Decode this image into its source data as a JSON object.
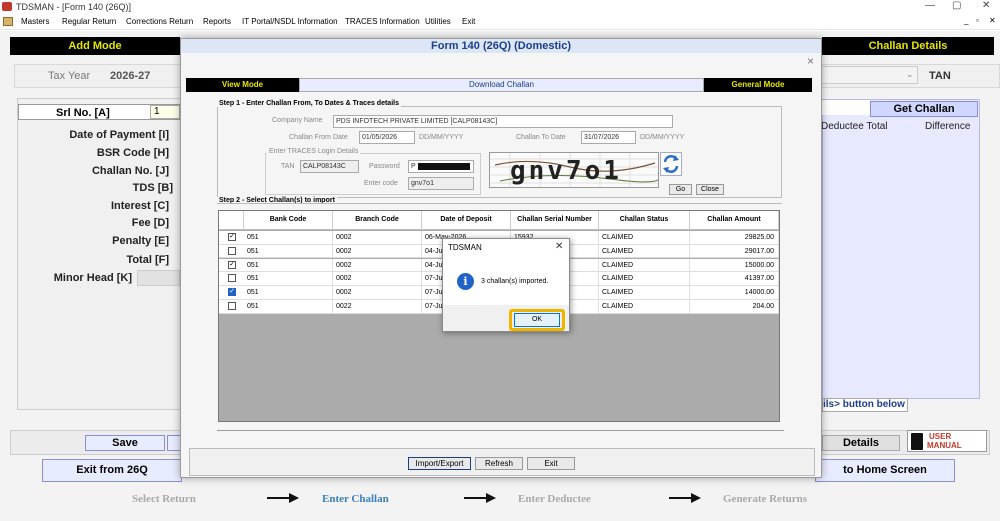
{
  "window": {
    "title": "TDSMAN - [Form 140 (26Q)]"
  },
  "window_controls": {
    "minimize": "—",
    "maximize": "▢",
    "close": "✕"
  },
  "mdi_controls": {
    "minimize": "_",
    "restore": "▫",
    "close": "✕"
  },
  "menu": [
    "Masters",
    "Regular Return",
    "Corrections Return",
    "Reports",
    "IT Portal/NSDL Information",
    "TRACES Information",
    "Utilities",
    "Exit"
  ],
  "background": {
    "add_mode": "Add Mode",
    "challan_details": "Challan Details",
    "tax_year_label": "Tax Year",
    "tax_year_value": "2026-27",
    "tan_label": "TAN",
    "srl_no_label": "Srl No. [A]",
    "srl_no_value": "1",
    "labels": [
      "Date of Payment [I]",
      "BSR Code [H]",
      "Challan No. [J]",
      "TDS [B]",
      "Interest [C]",
      "Fee [D]",
      "Penalty [E]",
      "Total [F]",
      "Minor Head [K]"
    ],
    "get_challan": "Get Challan",
    "deductee_total": "Deductee Total",
    "difference": "Difference",
    "button_below_hint": "ils> button below",
    "save": "Save",
    "details": "Details",
    "user_manual_1": "USER",
    "user_manual_2": "MANUAL",
    "exit_from": "Exit from 26Q",
    "to_home": "to Home Screen"
  },
  "modal": {
    "title": "Form 140 (26Q) (Domestic)",
    "close": "×",
    "view_mode": "View Mode",
    "download_challan": "Download Challan",
    "general_mode": "General Mode",
    "step1_title": "Step 1 - Enter Challan From, To Dates & Traces details",
    "company_name_label": "Company Name",
    "company_name_value": "PDS INFOTECH PRIVATE LIMITED [CALP08143C]",
    "challan_from_label": "Challan From Date",
    "challan_from_value": "01/05/2026",
    "date_format_1": "DD/MM/YYYY",
    "challan_to_label": "Challan To Date",
    "challan_to_value": "31/07/2026",
    "date_format_2": "DD/MM/YYYY",
    "traces_login_title": "Enter TRACES Login Details",
    "tan_label": "TAN",
    "tan_value": "CALP08143C",
    "password_label": "Password",
    "password_value": "P",
    "enter_code_label": "Enter code",
    "enter_code_value": "gnv7o1",
    "captcha_text": "gnv7o1",
    "go": "Go",
    "close_btn": "Close",
    "step2_title": "Step 2 - Select Challan(s) to import",
    "columns": [
      "Bank Code",
      "Branch Code",
      "Date of Deposit",
      "Challan Serial Number",
      "Challan Status",
      "Challan Amount"
    ],
    "rows": [
      {
        "checked": true,
        "bank": "051",
        "branch": "0002",
        "date": "06-May-2026",
        "serial": "15932",
        "status": "CLAIMED",
        "amount": "29825.00"
      },
      {
        "checked": false,
        "bank": "051",
        "branch": "0002",
        "date": "04-Jun",
        "serial": "",
        "status": "CLAIMED",
        "amount": "29017.00"
      },
      {
        "checked": true,
        "bank": "051",
        "branch": "0002",
        "date": "04-Jun",
        "serial": "",
        "status": "CLAIMED",
        "amount": "15000.00"
      },
      {
        "checked": false,
        "bank": "051",
        "branch": "0002",
        "date": "07-Jul",
        "serial": "",
        "status": "CLAIMED",
        "amount": "41397.00"
      },
      {
        "checked": true,
        "bank": "051",
        "branch": "0002",
        "date": "07-Jul",
        "serial": "",
        "status": "CLAIMED",
        "amount": "14000.00"
      },
      {
        "checked": false,
        "bank": "051",
        "branch": "0022",
        "date": "07-Jul",
        "serial": "",
        "status": "CLAIMED",
        "amount": "204.00"
      }
    ],
    "import_export": "Import/Export",
    "refresh": "Refresh",
    "exit": "Exit"
  },
  "dialog": {
    "title": "TDSMAN",
    "close": "✕",
    "message": "3 challan(s) imported.",
    "ok": "OK"
  },
  "steps": [
    "Select Return",
    "Enter Challan",
    "Enter Deductee",
    "Generate Returns"
  ],
  "colors": {
    "accent_blue": "#1b3e8c",
    "mode_bar_bg": "#000000",
    "mode_bar_text": "#e6e600",
    "highlight": "#f0b400"
  }
}
